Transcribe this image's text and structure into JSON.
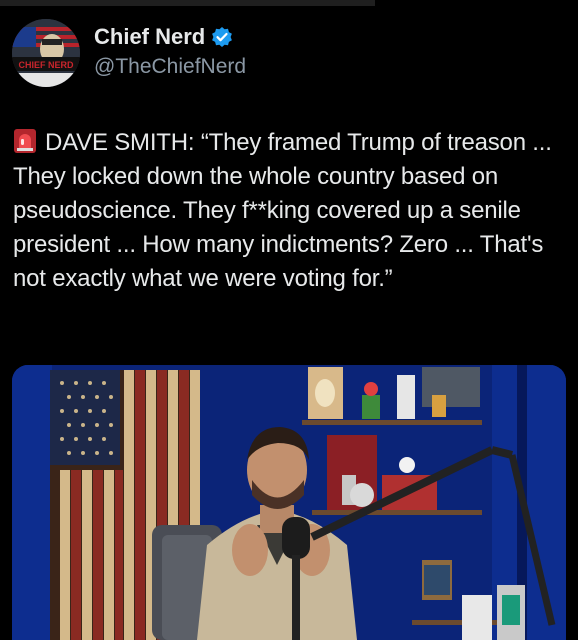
{
  "author": {
    "name": "Chief Nerd",
    "handle": "@TheChiefNerd",
    "avatar_text": "CHIEF NERD",
    "verified": true
  },
  "tweet": {
    "emoji": "rotating-light-icon",
    "text": "DAVE SMITH: “They framed Trump of treason ... They locked down the whole country based on pseudoscience. They f**king covered up a senile president ... How many indictments? Zero ... That's not exactly what we were voting for.”"
  },
  "media": {
    "type": "video-frame",
    "description_icon": "podcast-scene"
  },
  "colors": {
    "background": "#000000",
    "text": "#e7e9ea",
    "secondary": "#8b98a5",
    "verified_blue": "#1d9bf0"
  }
}
